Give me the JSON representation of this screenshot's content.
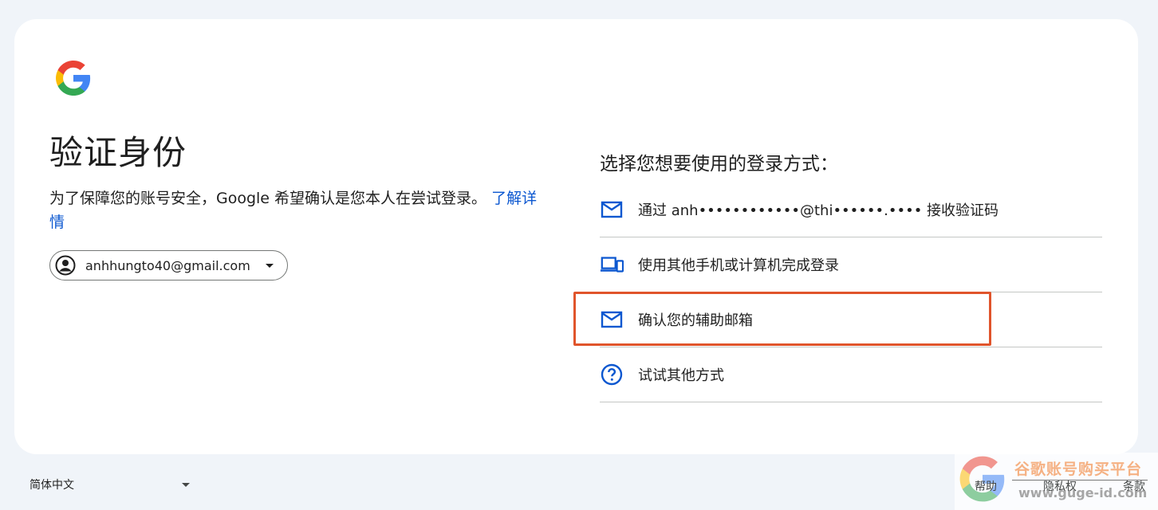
{
  "page": {
    "title": "验证身份",
    "description": "为了保障您的账号安全，Google 希望确认是您本人在尝试登录。",
    "learn_more": "了解详情"
  },
  "account": {
    "email": "anhhungto40@gmail.com"
  },
  "methods": {
    "heading": "选择您想要使用的登录方式：",
    "items": [
      {
        "label": "通过 anh••••••••••••@thi••••••.•••• 接收验证码",
        "icon": "mail-icon"
      },
      {
        "label": "使用其他手机或计算机完成登录",
        "icon": "devices-icon"
      },
      {
        "label": "确认您的辅助邮箱",
        "icon": "mail-icon"
      },
      {
        "label": "试试其他方式",
        "icon": "help-circle-icon"
      }
    ]
  },
  "footer": {
    "language": "简体中文",
    "help": "帮助",
    "privacy": "隐私权",
    "terms": "条款"
  },
  "watermark": {
    "title": "谷歌账号购买平台",
    "url": "www.guge-id.com"
  },
  "colors": {
    "link": "#0b57d0",
    "highlight_border": "#e0542b",
    "divider": "#c4c7c5",
    "background": "#f0f4f9"
  }
}
